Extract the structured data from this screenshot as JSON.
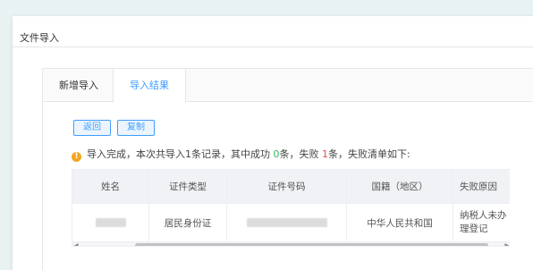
{
  "window": {
    "title": "文件导入"
  },
  "tabs": [
    {
      "label": "新增导入",
      "active": false
    },
    {
      "label": "导入结果",
      "active": true
    }
  ],
  "buttons": {
    "back": "返回",
    "copy": "复制"
  },
  "notice": {
    "icon": "warning-icon",
    "prefix": "导入完成，本次共导入1条记录，其中成功 ",
    "success_count": "0",
    "mid": "条，失败 ",
    "fail_count": "1",
    "suffix": "条，失败清单如下:"
  },
  "table": {
    "columns": [
      "姓名",
      "证件类型",
      "证件号码",
      "国籍（地区）",
      "失败原因"
    ],
    "rows": [
      {
        "name": "",
        "id_type": "居民身份证",
        "id_number": "",
        "nationality": "中华人民共和国",
        "reason": "纳税人未办理登记"
      }
    ]
  },
  "colors": {
    "accent": "#409eff",
    "success": "#2eb85c",
    "fail": "#e24b4b",
    "warning": "#f5a623"
  }
}
